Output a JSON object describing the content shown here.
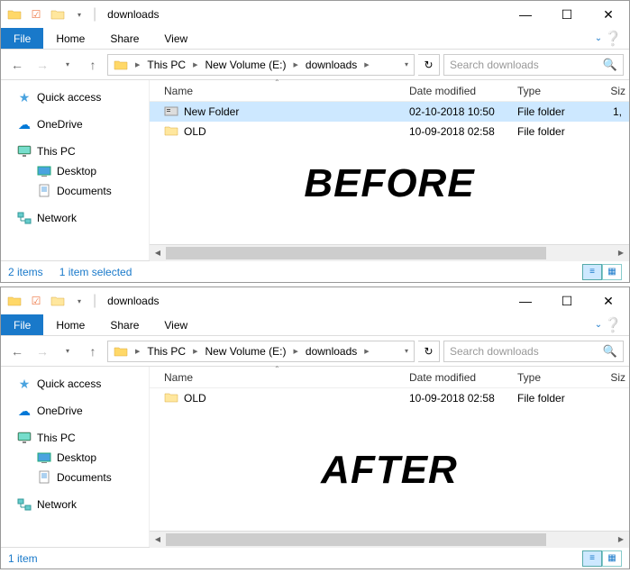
{
  "windows": [
    {
      "title": "downloads",
      "ribbon": {
        "file": "File",
        "tabs": [
          "Home",
          "Share",
          "View"
        ]
      },
      "breadcrumb": [
        "This PC",
        "New Volume (E:)",
        "downloads"
      ],
      "search_placeholder": "Search downloads",
      "sidebar": [
        {
          "label": "Quick access",
          "icon": "star",
          "level": 1
        },
        {
          "label": "OneDrive",
          "icon": "cloud",
          "level": 1
        },
        {
          "label": "This PC",
          "icon": "monitor",
          "level": 1
        },
        {
          "label": "Desktop",
          "icon": "desktop",
          "level": 2
        },
        {
          "label": "Documents",
          "icon": "doc",
          "level": 2
        },
        {
          "label": "Network",
          "icon": "network",
          "level": 1
        }
      ],
      "columns": {
        "name": "Name",
        "date": "Date modified",
        "type": "Type",
        "size": "Siz"
      },
      "rows": [
        {
          "name": "New Folder",
          "date": "02-10-2018 10:50",
          "type": "File folder",
          "size": "1,",
          "selected": true,
          "icon": "folder-special"
        },
        {
          "name": "OLD",
          "date": "10-09-2018 02:58",
          "type": "File folder",
          "size": "",
          "selected": false,
          "icon": "folder"
        }
      ],
      "status": [
        "2 items",
        "1 item selected"
      ],
      "overlay": "BEFORE"
    },
    {
      "title": "downloads",
      "ribbon": {
        "file": "File",
        "tabs": [
          "Home",
          "Share",
          "View"
        ]
      },
      "breadcrumb": [
        "This PC",
        "New Volume (E:)",
        "downloads"
      ],
      "search_placeholder": "Search downloads",
      "sidebar": [
        {
          "label": "Quick access",
          "icon": "star",
          "level": 1
        },
        {
          "label": "OneDrive",
          "icon": "cloud",
          "level": 1
        },
        {
          "label": "This PC",
          "icon": "monitor",
          "level": 1
        },
        {
          "label": "Desktop",
          "icon": "desktop",
          "level": 2
        },
        {
          "label": "Documents",
          "icon": "doc",
          "level": 2
        },
        {
          "label": "Network",
          "icon": "network",
          "level": 1
        }
      ],
      "columns": {
        "name": "Name",
        "date": "Date modified",
        "type": "Type",
        "size": "Siz"
      },
      "rows": [
        {
          "name": "OLD",
          "date": "10-09-2018 02:58",
          "type": "File folder",
          "size": "",
          "selected": false,
          "icon": "folder"
        }
      ],
      "status": [
        "1 item"
      ],
      "overlay": "AFTER"
    }
  ]
}
